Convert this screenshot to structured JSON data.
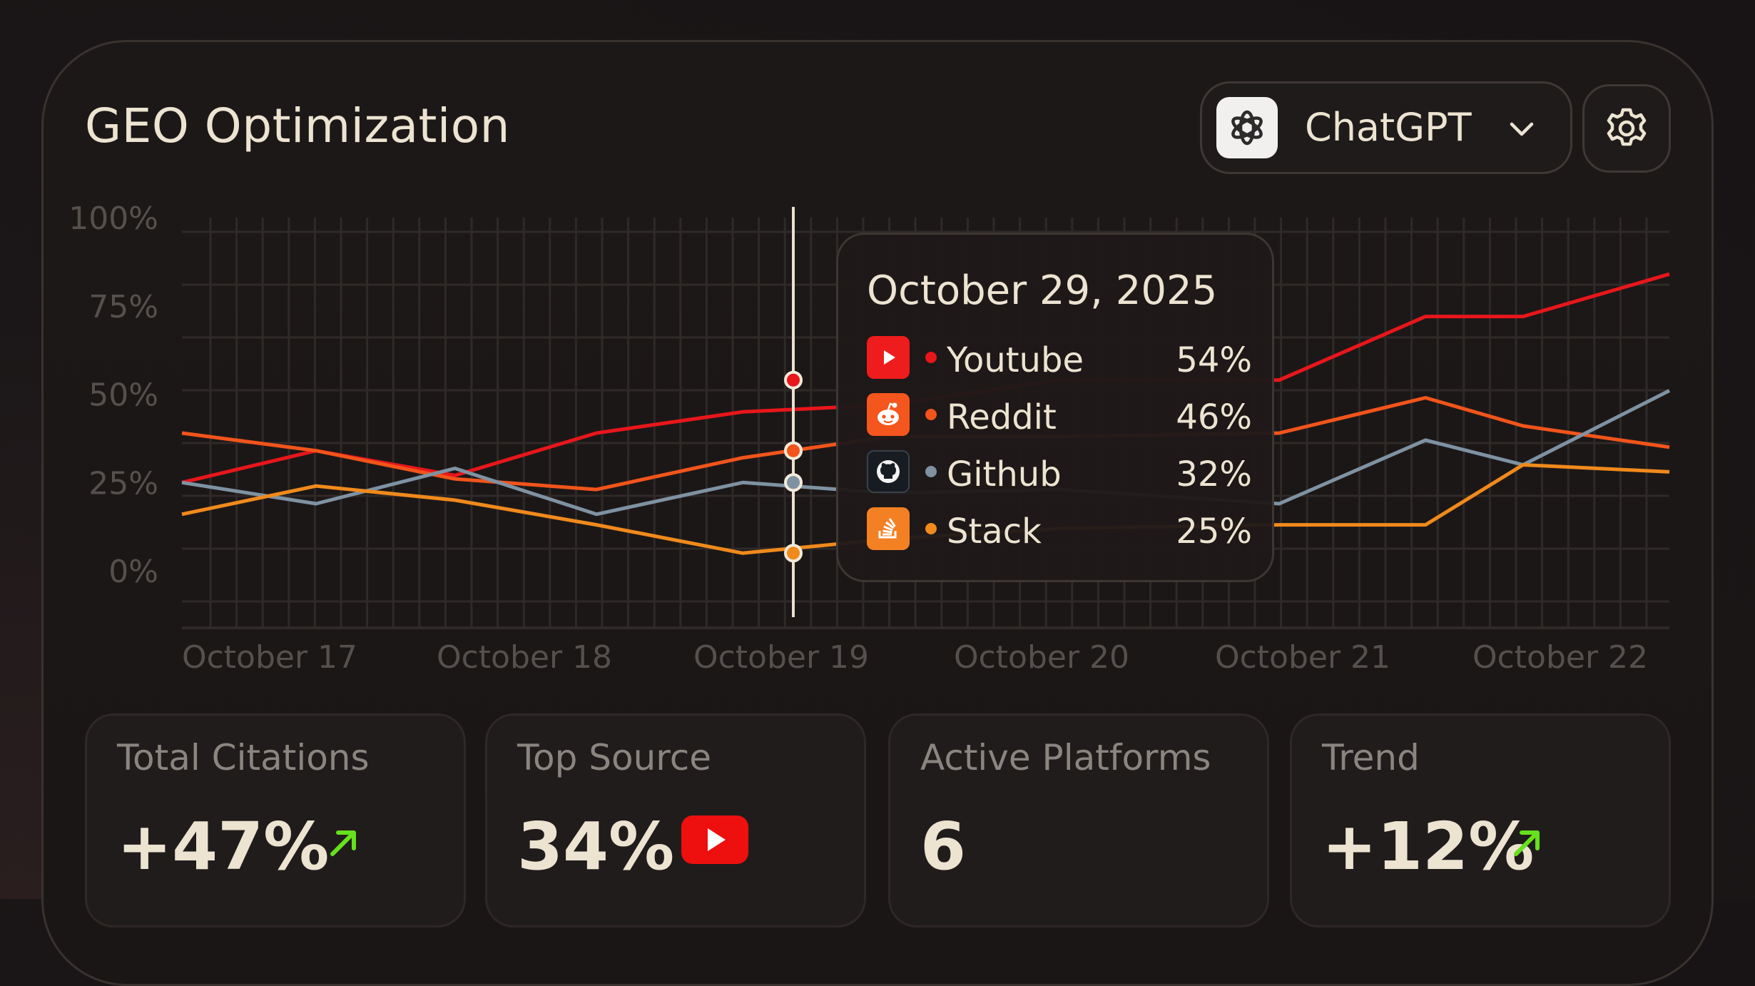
{
  "header": {
    "title": "GEO Optimization"
  },
  "model_select": {
    "label": "ChatGPT",
    "logo_icon": "openai-logo-icon",
    "chevron_icon": "chevron-down-icon"
  },
  "settings": {
    "icon": "gear-icon"
  },
  "chart_data": {
    "type": "line",
    "x": [
      "October 17",
      "October 18",
      "October 19",
      "October 20",
      "October 21",
      "October 22"
    ],
    "ylim": [
      -15,
      110
    ],
    "yticks": [
      "100%",
      "75%",
      "50%",
      "25%",
      "0%"
    ],
    "grid": true,
    "series": [
      {
        "name": "Youtube",
        "color": "#e8161b",
        "points": [
          [
            0,
            25
          ],
          [
            0.55,
            34
          ],
          [
            1.12,
            27
          ],
          [
            1.7,
            39
          ],
          [
            2.3,
            45
          ],
          [
            2.9,
            47
          ],
          [
            3.6,
            54
          ],
          [
            4.5,
            54
          ],
          [
            5.1,
            72
          ],
          [
            5.5,
            72
          ],
          [
            6.1,
            84
          ]
        ]
      },
      {
        "name": "Reddit",
        "color": "#f2541b",
        "points": [
          [
            0,
            39
          ],
          [
            0.55,
            34
          ],
          [
            1.12,
            26
          ],
          [
            1.7,
            23
          ],
          [
            2.3,
            32
          ],
          [
            2.9,
            38
          ],
          [
            3.6,
            38
          ],
          [
            4.5,
            39
          ],
          [
            5.1,
            49
          ],
          [
            5.5,
            41
          ],
          [
            6.1,
            35
          ]
        ]
      },
      {
        "name": "Github",
        "color": "#7e92a2",
        "points": [
          [
            0,
            25
          ],
          [
            0.55,
            19
          ],
          [
            1.12,
            29
          ],
          [
            1.7,
            16
          ],
          [
            2.3,
            25
          ],
          [
            2.9,
            22
          ],
          [
            3.6,
            23
          ],
          [
            4.5,
            19
          ],
          [
            5.1,
            37
          ],
          [
            5.5,
            30
          ],
          [
            6.1,
            51
          ]
        ]
      },
      {
        "name": "Stack",
        "color": "#f08a1c",
        "points": [
          [
            0,
            16
          ],
          [
            0.55,
            24
          ],
          [
            1.12,
            20
          ],
          [
            1.7,
            13
          ],
          [
            2.3,
            5
          ],
          [
            2.9,
            9
          ],
          [
            3.6,
            12
          ],
          [
            4.5,
            13
          ],
          [
            5.1,
            13
          ],
          [
            5.5,
            30
          ],
          [
            6.1,
            28
          ]
        ]
      }
    ],
    "hover": {
      "x": 2.3,
      "date": "October 29, 2025"
    }
  },
  "tooltip": {
    "date": "October 29, 2025",
    "rows": [
      {
        "name": "Youtube",
        "value": "54%",
        "icon": "youtube-icon",
        "color": "#e8161b"
      },
      {
        "name": "Reddit",
        "value": "46%",
        "icon": "reddit-icon",
        "color": "#f2541b"
      },
      {
        "name": "Github",
        "value": "32%",
        "icon": "github-icon",
        "color": "#7e92a2"
      },
      {
        "name": "Stack",
        "value": "25%",
        "icon": "stackoverflow-icon",
        "color": "#f08a1c"
      }
    ]
  },
  "stats": [
    {
      "label": "Total Citations",
      "value": "+47%",
      "icon": "arrow-up-right-icon",
      "accent": "#66e01c"
    },
    {
      "label": "Top Source",
      "value": "34%",
      "icon": "youtube-icon"
    },
    {
      "label": "Active Platforms",
      "value": "6"
    },
    {
      "label": "Trend",
      "value": "+12%",
      "icon": "arrow-up-right-icon",
      "accent": "#66e01c"
    }
  ]
}
